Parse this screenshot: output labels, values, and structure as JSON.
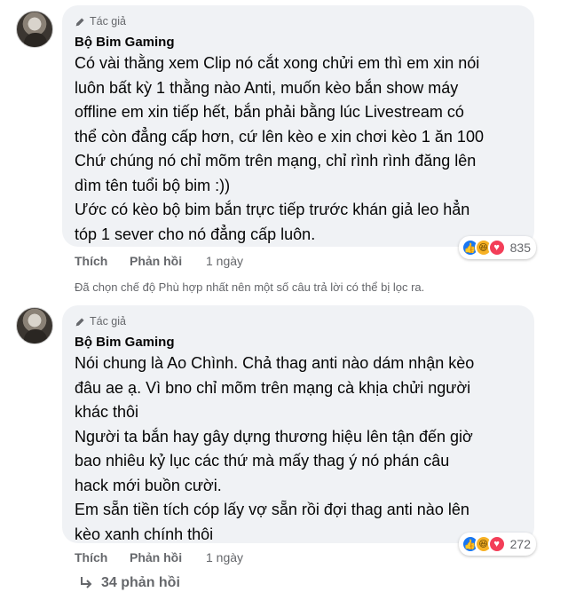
{
  "comments": [
    {
      "badge": "Tác giả",
      "author": "Bộ Bim Gaming",
      "lines": [
        "Có vài thằng xem Clip nó cắt xong chửi em thì em xin nói",
        "luôn bất kỳ 1 thằng nào Anti, muốn kèo bắn show máy",
        "offline em xin tiếp hết, bắn phải bằng lúc Livestream có",
        "thể còn đẳng cấp hơn, cứ lên kèo e xin chơi kèo 1 ăn 100",
        "Chứ chúng nó chỉ mõm trên mạng, chỉ rình rình đăng lên",
        "dìm tên tuổi bộ bim :))",
        "Ước có kèo bộ bim bắn trực tiếp trước khán giả leo hẳn",
        "tóp 1 sever cho nó đẳng cấp luôn."
      ],
      "reaction_count": "835",
      "like_label": "Thích",
      "reply_label": "Phản hồi",
      "time": "1 ngày"
    },
    {
      "badge": "Tác giả",
      "author": "Bộ Bim Gaming",
      "lines": [
        "Nói chung là Ao Chình. Chả thag anti nào dám nhận kèo",
        "đâu ae ạ. Vì bno chỉ mõm trên mạng cà khịa chửi người",
        "khác thôi",
        "Người ta bắn hay gây dựng thương hiệu lên tận đến giờ",
        "bao nhiêu kỷ lục các thứ mà mấy thag ý nó phán câu",
        "hack mới buồn cười.",
        "Em sẵn tiền tích cóp lấy vợ sẵn rồi đợi thag anti nào lên",
        "kèo xanh chính thôi"
      ],
      "reaction_count": "272",
      "like_label": "Thích",
      "reply_label": "Phản hồi",
      "time": "1 ngày"
    }
  ],
  "filter_note": "Đã chọn chế độ Phù hợp nhất nên một số câu trả lời có thể bị lọc ra.",
  "replies_link": "34 phản hồi",
  "icons": {
    "badge": "pencil-icon",
    "replies": "reply-arrow-icon",
    "reactions": [
      "like-icon",
      "haha-icon",
      "love-icon"
    ]
  },
  "colors": {
    "bubble": "#f0f2f5",
    "secondary_text": "#65676b",
    "like": "#1877f2",
    "love": "#f33e58",
    "haha": "#f7b125"
  }
}
